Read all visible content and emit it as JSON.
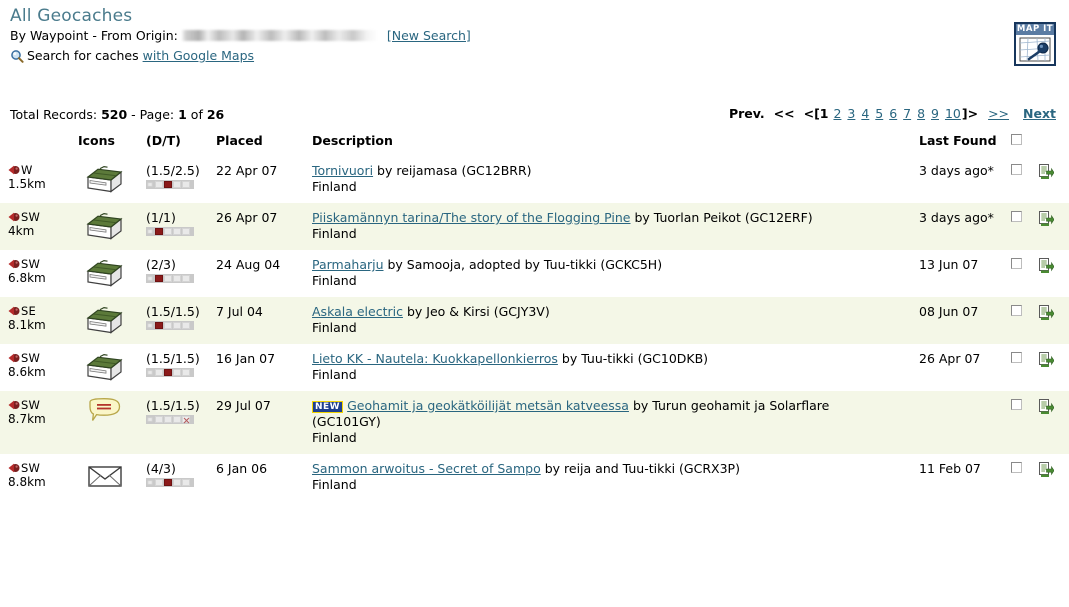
{
  "header": {
    "title": "All Geocaches",
    "origin_prefix": "By Waypoint - From Origin:",
    "origin_value_redacted": "",
    "new_search": "[New Search]",
    "search_prefix": "Search for caches",
    "gmaps_link": "with Google Maps",
    "map_it_label": "MAP IT",
    "search_icon": "magnifier-icon",
    "map_it_icon": "map-magnifier-icon"
  },
  "pager": {
    "total_label": "Total Records:",
    "total_value": "520",
    "page_label": "- Page:",
    "page_current": "1",
    "page_of": "of",
    "page_total": "26",
    "prev_label": "Prev.",
    "first_label": "<<",
    "open_bracket": "<[",
    "close_bracket": "]>",
    "last_label": ">>",
    "next_label": "Next",
    "pages": [
      "1",
      "2",
      "3",
      "4",
      "5",
      "6",
      "7",
      "8",
      "9",
      "10"
    ],
    "current_index": 0
  },
  "columns": {
    "dir": "",
    "icons": "Icons",
    "dt": "(D/T)",
    "placed": "Placed",
    "description": "Description",
    "last_found": "Last Found",
    "check": "",
    "gpx": ""
  },
  "colors": {
    "title": "#4a7b8c",
    "link": "#2a6680",
    "row_alt_bg": "#f4f7e7",
    "new_badge_bg": "#1f3f8f",
    "new_badge_border": "#f2d500",
    "size_on": "#8b1a1a",
    "mapit_border": "#17365c",
    "mapit_label_bg": "#5b7ca3",
    "cache_green": "#4c6b33",
    "event_yellow": "#f7f3c0",
    "gpx_green": "#4a8b33"
  },
  "rows": [
    {
      "direction": "W",
      "distance": "1.5km",
      "cache_type": "traditional-cache-icon",
      "dt": "(1.5/2.5)",
      "size_index": 2,
      "size_unknown": false,
      "placed": "22 Apr 07",
      "is_new": false,
      "title": "Tornivuori",
      "by": "by reijamasa (GC12BRR)",
      "country": "Finland",
      "last_found": "3 days ago*"
    },
    {
      "direction": "SW",
      "distance": "4km",
      "cache_type": "traditional-cache-icon",
      "dt": "(1/1)",
      "size_index": 1,
      "size_unknown": false,
      "placed": "26 Apr 07",
      "is_new": false,
      "title": "Piiskamännyn tarina/The story of the Flogging Pine",
      "by": "by Tuorlan Peikot (GC12ERF)",
      "country": "Finland",
      "last_found": "3 days ago*"
    },
    {
      "direction": "SW",
      "distance": "6.8km",
      "cache_type": "traditional-cache-icon",
      "dt": "(2/3)",
      "size_index": 1,
      "size_unknown": false,
      "placed": "24 Aug 04",
      "is_new": false,
      "title": "Parmaharju",
      "by": "by Samooja, adopted by Tuu-tikki (GCKC5H)",
      "country": "Finland",
      "last_found": "13 Jun 07"
    },
    {
      "direction": "SE",
      "distance": "8.1km",
      "cache_type": "traditional-cache-icon",
      "dt": "(1.5/1.5)",
      "size_index": 1,
      "size_unknown": false,
      "placed": "7 Jul 04",
      "is_new": false,
      "title": "Askala electric",
      "by": "by Jeo & Kirsi (GCJY3V)",
      "country": "Finland",
      "last_found": "08 Jun 07"
    },
    {
      "direction": "SW",
      "distance": "8.6km",
      "cache_type": "traditional-cache-icon",
      "dt": "(1.5/1.5)",
      "size_index": 2,
      "size_unknown": false,
      "placed": "16 Jan 07",
      "is_new": false,
      "title": "Lieto KK - Nautela: Kuokkapellonkierros",
      "by": "by Tuu-tikki (GC10DKB)",
      "country": "Finland",
      "last_found": "26 Apr 07"
    },
    {
      "direction": "SW",
      "distance": "8.7km",
      "cache_type": "event-cache-icon",
      "dt": "(1.5/1.5)",
      "size_index": -1,
      "size_unknown": true,
      "placed": "29 Jul 07",
      "is_new": true,
      "new_label": "NEW",
      "title": "Geohamit ja geokätköilijät metsän katveessa",
      "by": "by Turun geohamit ja Solarflare",
      "by_extra": "(GC101GY)",
      "country": "Finland",
      "last_found": ""
    },
    {
      "direction": "SW",
      "distance": "8.8km",
      "cache_type": "letterbox-cache-icon",
      "dt": "(4/3)",
      "size_index": 2,
      "size_unknown": false,
      "placed": "6 Jan 06",
      "is_new": false,
      "title": "Sammon arwoitus - Secret of Sampo",
      "by": "by reija and Tuu-tikki (GCRX3P)",
      "country": "Finland",
      "last_found": "11 Feb 07"
    }
  ]
}
